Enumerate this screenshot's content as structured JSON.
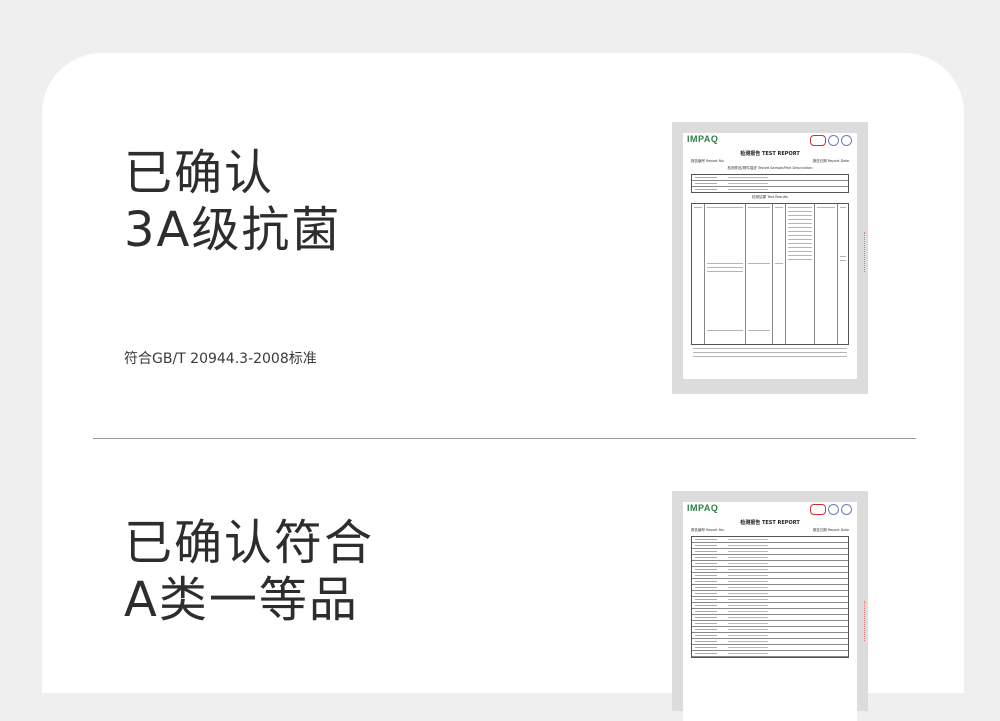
{
  "section1": {
    "headline": [
      "已确认",
      "3A级抗菌"
    ],
    "standard": "符合GB/T 20944.3-2008标准",
    "report": {
      "logo": "IMPAQ",
      "title": "检测报告 TEST REPORT",
      "report_no": "报告编号 Report No.",
      "report_date": "报告日期 Report Date",
      "subtitle": "检测样品/物件描述 Tested Sample/Part Description",
      "results": "检测结果 Test Results"
    }
  },
  "section2": {
    "headline": [
      "已确认符合",
      "A类一等品"
    ],
    "report": {
      "logo": "IMPAQ",
      "title": "检测报告 TEST REPORT",
      "report_no": "报告编号 Report No.",
      "report_date": "报告日期 Report Date"
    }
  }
}
